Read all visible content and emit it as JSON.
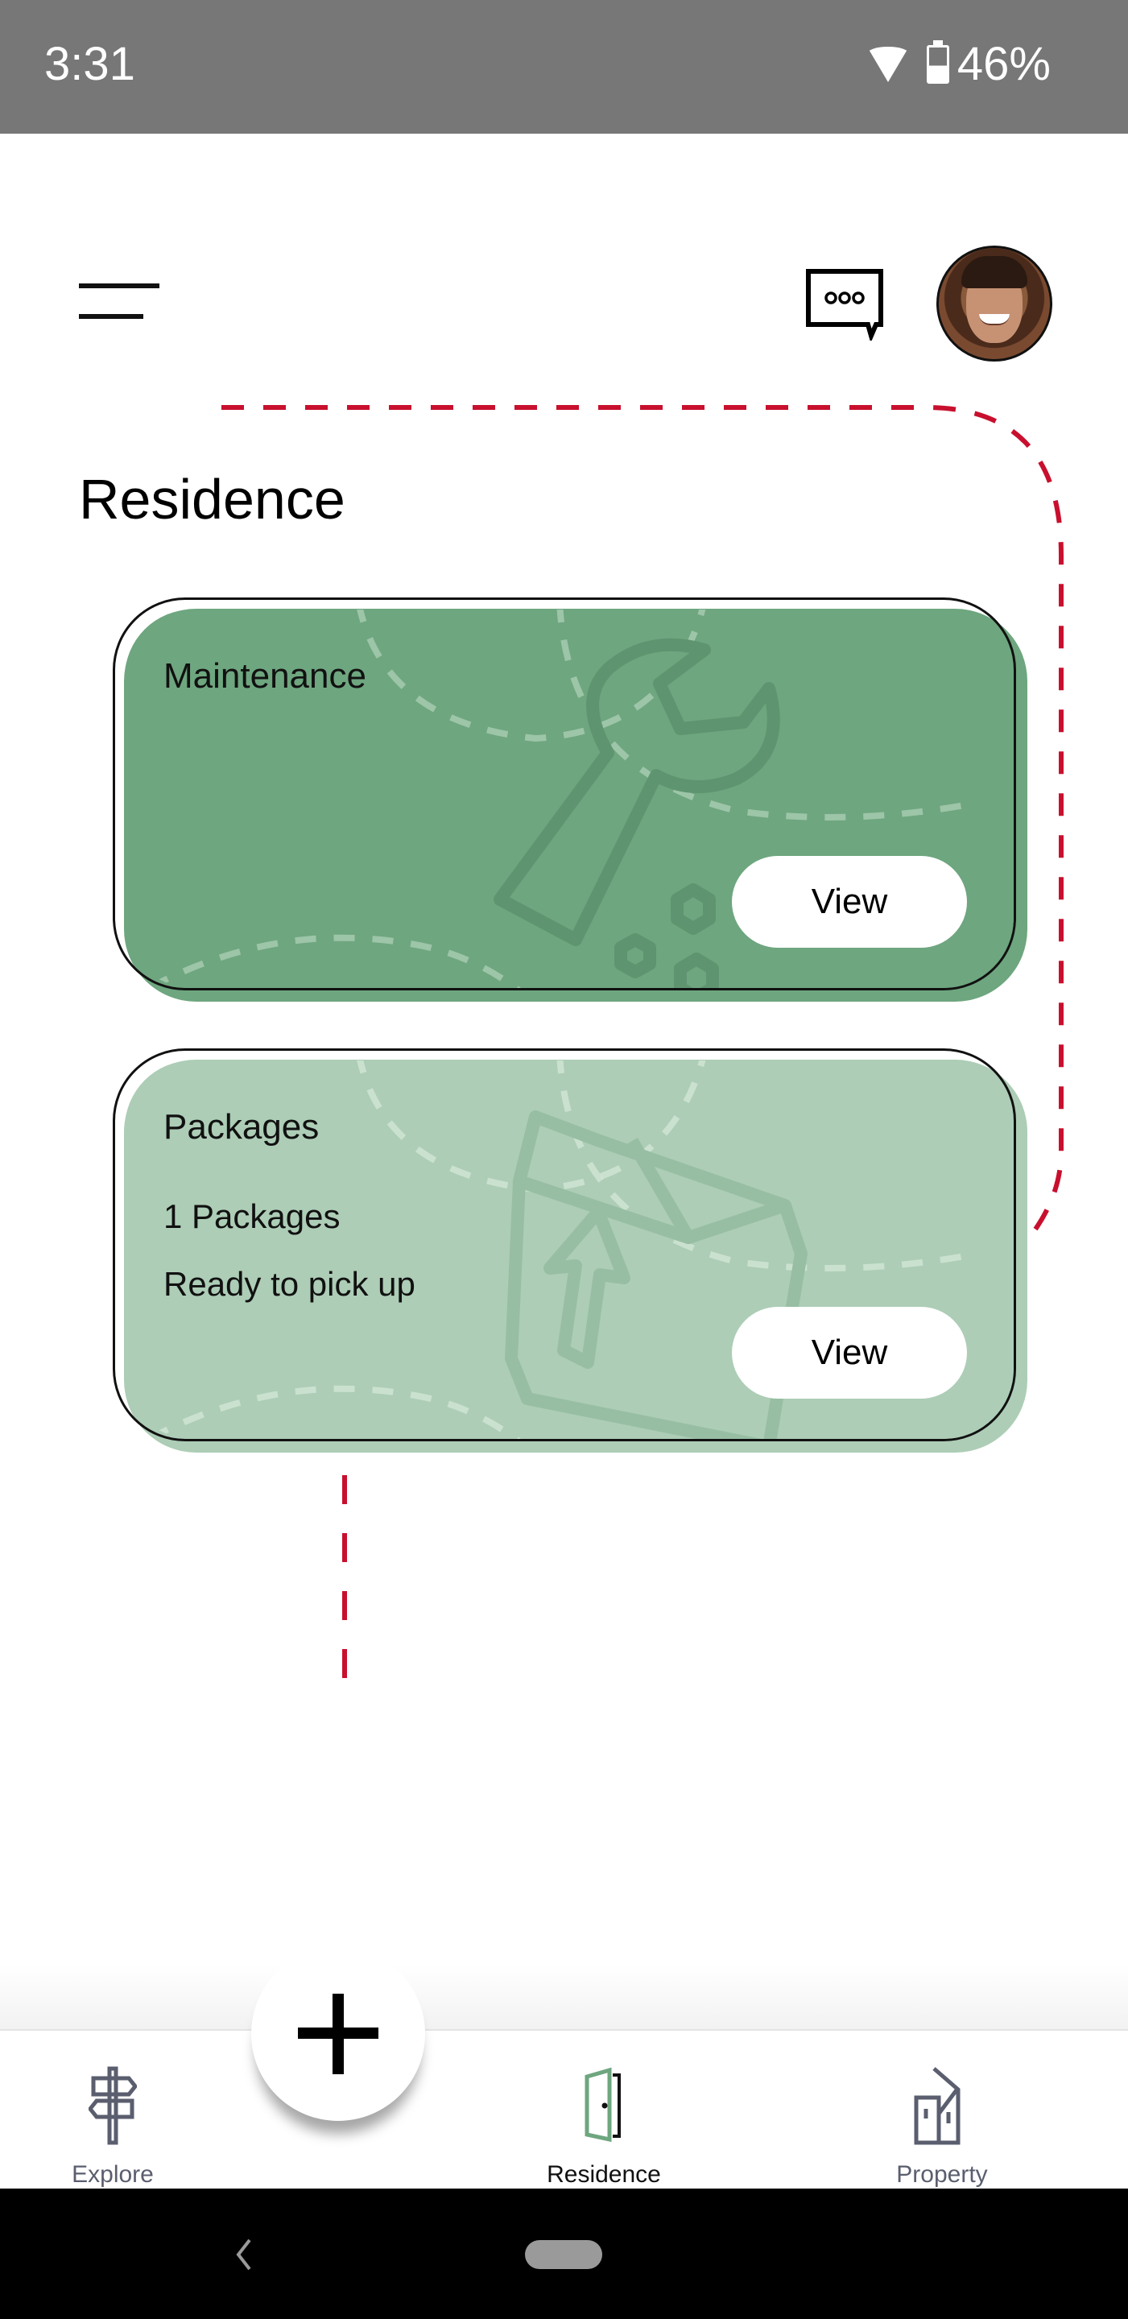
{
  "status_bar": {
    "time": "3:31",
    "battery_percent": "46%",
    "icons": [
      "wifi-icon",
      "battery-icon"
    ]
  },
  "header": {
    "menu_icon": "hamburger-menu-icon",
    "chat_icon": "chat-bubble-icon",
    "avatar": "user-avatar"
  },
  "page": {
    "title": "Residence"
  },
  "colors": {
    "route_dash": "#c8102e",
    "maintenance_card": "#6ea67f",
    "packages_card": "#adcdb6",
    "active_nav_icon": "#6ea67f",
    "inactive_nav": "#5a5e6e"
  },
  "cards": [
    {
      "title": "Maintenance",
      "lines": [],
      "button_label": "View",
      "icon": "wrench-icon"
    },
    {
      "title": "Packages",
      "lines": [
        "1 Packages",
        "Ready to pick up"
      ],
      "button_label": "View",
      "icon": "package-box-icon"
    }
  ],
  "fab": {
    "icon": "plus-icon"
  },
  "bottom_nav": {
    "items": [
      {
        "label": "Explore",
        "icon": "signpost-icon",
        "active": false
      },
      {
        "label": "Residence",
        "icon": "door-icon",
        "active": true
      },
      {
        "label": "Property",
        "icon": "buildings-icon",
        "active": false
      }
    ]
  },
  "system_nav": {
    "back": "back-chevron-icon",
    "home": "home-pill"
  }
}
